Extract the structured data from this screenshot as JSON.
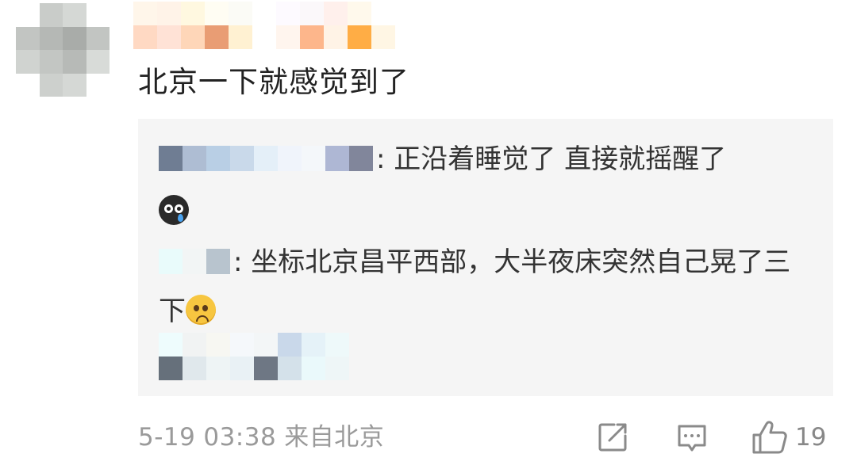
{
  "comment": {
    "text": "北京一下就感觉到了"
  },
  "replies": [
    {
      "sep": ":",
      "text": " 正沿着睡觉了 直接就摇醒了",
      "emoji": "crying-face-emoji"
    },
    {
      "sep": ":",
      "text": " 坐标北京昌平西部，大半夜床突然自己晃了三下",
      "emoji": "sad-face-emoji"
    }
  ],
  "footer": {
    "date": "5-19",
    "time": "03:38",
    "location": "来自北京"
  },
  "actions": {
    "like_count": "19"
  },
  "colors": {
    "text_primary": "#222222",
    "text_secondary": "#9a9a9a",
    "reply_bg": "#f5f5f5",
    "icon": "#888888"
  }
}
